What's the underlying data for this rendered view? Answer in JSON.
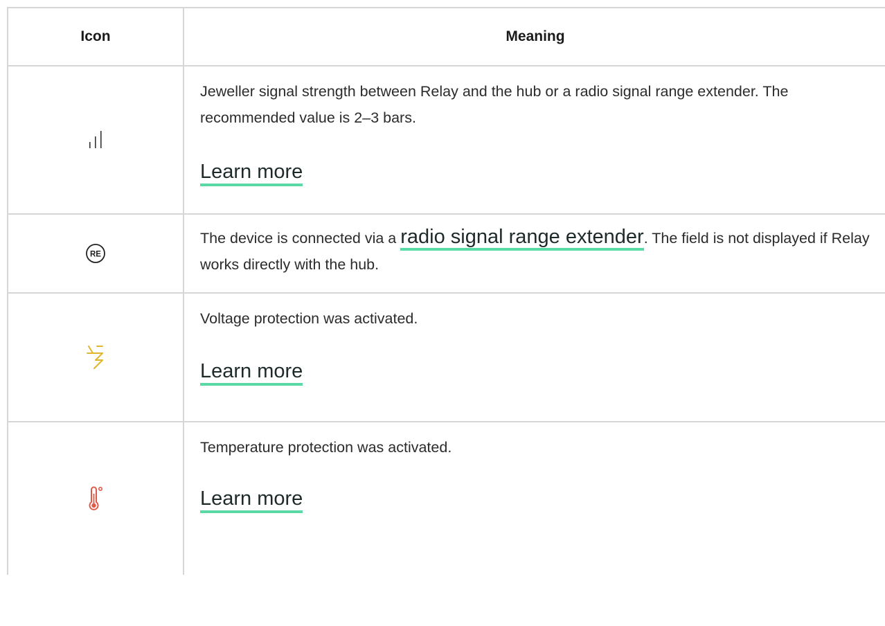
{
  "table": {
    "headers": {
      "icon": "Icon",
      "meaning": "Meaning"
    },
    "rows": [
      {
        "icon": "signal-strength-icon",
        "text": "Jeweller signal strength between Relay and the hub or a radio signal range extender. The recommended value is 2–3 bars.",
        "link": "Learn more"
      },
      {
        "icon": "range-extender-re-icon",
        "text_before": "The device is connected via a",
        "link": "radio signal range extender",
        "text_after": ". The field is not displayed if Relay works directly with the hub.",
        "icon_label": "RE"
      },
      {
        "icon": "voltage-lightning-icon",
        "icon_color": "#e3b52b",
        "text": "Voltage protection was activated.",
        "link": "Learn more"
      },
      {
        "icon": "thermometer-icon",
        "icon_color": "#e05a4a",
        "text": "Temperature protection was activated.",
        "link": "Learn more"
      }
    ]
  },
  "colors": {
    "link_underline": "#5ad9a4",
    "border": "#d6d6d6"
  }
}
